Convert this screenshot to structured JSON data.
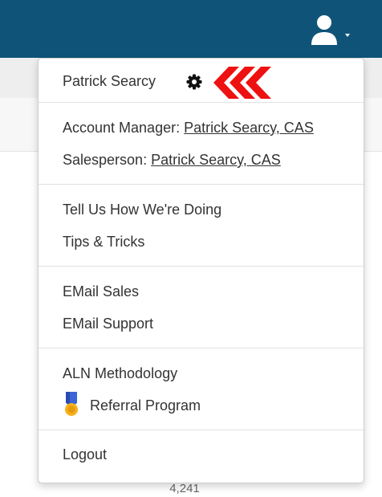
{
  "header": {
    "bg_color": "#0f5478",
    "user_icon": "user-icon",
    "caret_icon": "caret-down-icon"
  },
  "menu": {
    "user_name": "Patrick Searcy",
    "settings_icon": "gear-icon",
    "annotation_icon": "red-chevrons-icon",
    "account_manager_label": "Account Manager:",
    "account_manager_name": "Patrick Searcy, CAS",
    "salesperson_label": "Salesperson:",
    "salesperson_name": "Patrick Searcy, CAS",
    "feedback": "Tell Us How We're Doing",
    "tips": "Tips & Tricks",
    "email_sales": "EMail Sales",
    "email_support": "EMail Support",
    "methodology": "ALN Methodology",
    "referral_icon": "medal-icon",
    "referral": "Referral Program",
    "logout": "Logout"
  },
  "background": {
    "count": "4,241"
  }
}
